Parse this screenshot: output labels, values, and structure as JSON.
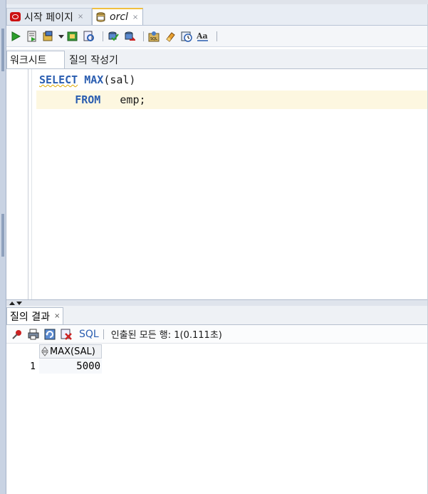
{
  "tabs": [
    {
      "label": "시작 페이지",
      "close": "×",
      "icon": "start-page-icon"
    },
    {
      "label": "orcl",
      "close": "×",
      "icon": "sql-worksheet-icon"
    }
  ],
  "worksheet_tabs": {
    "worksheet": "워크시트",
    "query_builder": "질의 작성기"
  },
  "editor": {
    "line1": {
      "kw1": "SELECT",
      "kw2": "MAX",
      "rest": "(sal)"
    },
    "line2": {
      "indent": "    ",
      "kw": "FROM",
      "rest": "   emp;"
    }
  },
  "results": {
    "tab_label": "질의 결과",
    "tab_close": "×",
    "sql_label": "SQL",
    "status": "인출된 모든 행: 1(0.111초)",
    "column_header": "MAX(SAL)",
    "rows": [
      {
        "num": "1",
        "value": "5000"
      }
    ]
  },
  "colors": {
    "keyword": "#2a5db0",
    "highlight_line": "#fdf7e0",
    "active_tab_top": "#f0c040"
  }
}
